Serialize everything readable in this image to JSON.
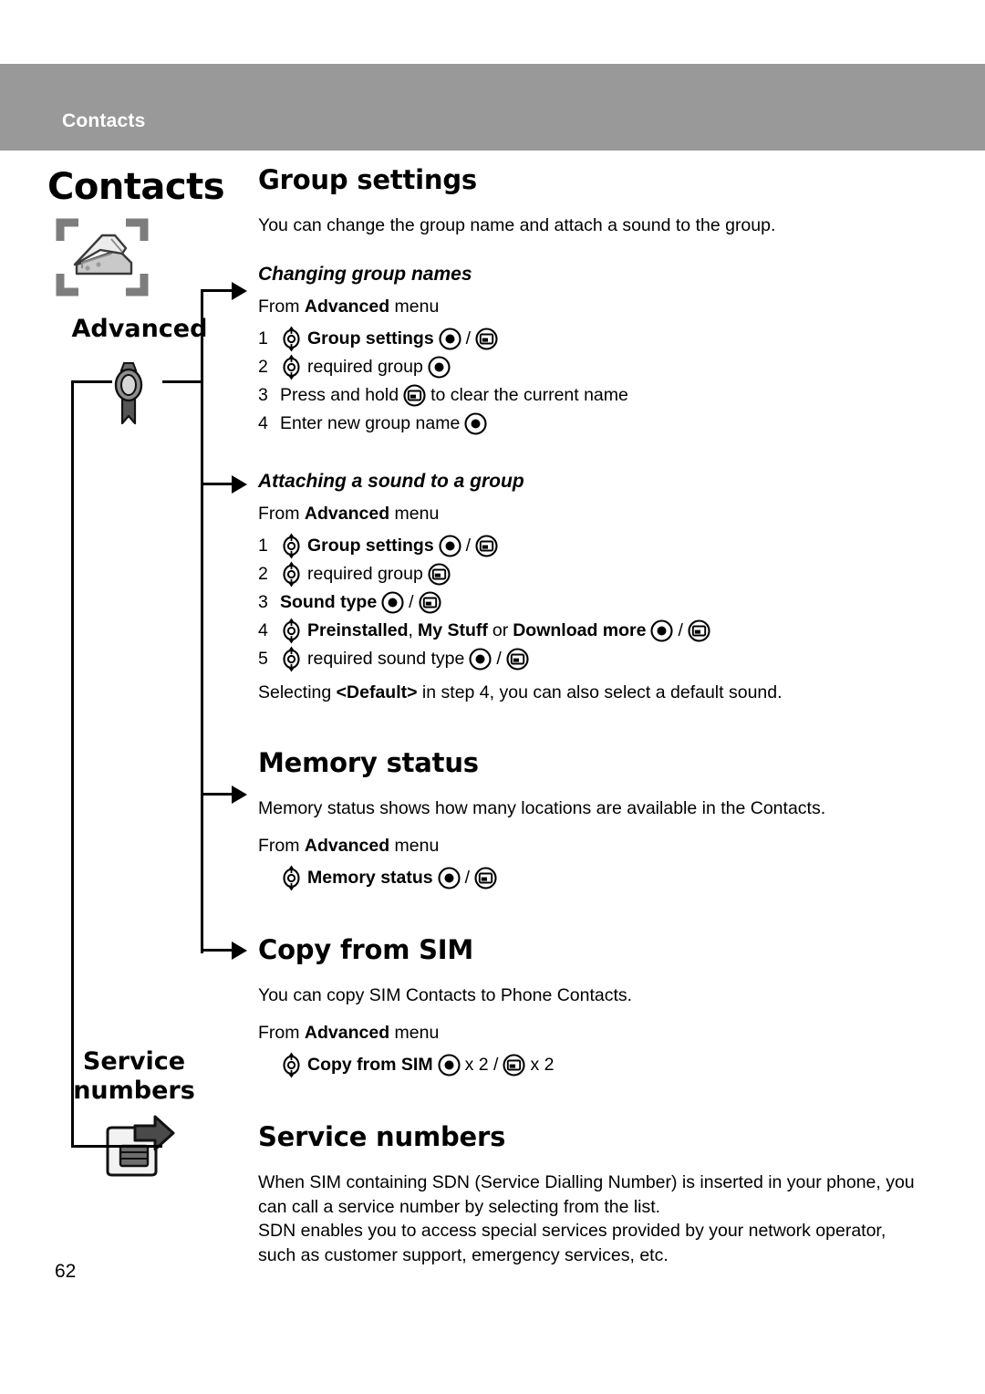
{
  "header": {
    "running_title": "Contacts",
    "band_color": "#999999"
  },
  "sidebar": {
    "chapter_title": "Contacts",
    "chapter_icon": "contacts-card-file-icon",
    "nav_items": [
      {
        "label": "Advanced",
        "icon": "award-ribbon-icon"
      },
      {
        "label": "Service\nnumbers",
        "label_line1": "Service",
        "label_line2": "numbers",
        "icon": "sim-card-export-icon"
      }
    ]
  },
  "icons": {
    "nav_key": "navigation-up-down-key-icon",
    "ok_key": "ok-select-key-icon",
    "soft_key": "left-soft-key-icon"
  },
  "content": {
    "sections": [
      {
        "id": "group-settings",
        "heading": "Group settings",
        "intro": "You can change the group name and attach a sound to the group.",
        "subsections": [
          {
            "id": "changing-group-names",
            "subheading": "Changing group names",
            "from_prefix": "From ",
            "from_bold": "Advanced",
            "from_suffix": " menu",
            "steps": [
              {
                "num": "1",
                "parts": [
                  {
                    "type": "icon",
                    "icon": "nav_key"
                  },
                  {
                    "type": "text",
                    "text": "Group settings",
                    "bold": true
                  },
                  {
                    "type": "icon",
                    "icon": "ok_key"
                  },
                  {
                    "type": "text",
                    "text": "/",
                    "bold": false
                  },
                  {
                    "type": "icon",
                    "icon": "soft_key"
                  }
                ]
              },
              {
                "num": "2",
                "parts": [
                  {
                    "type": "icon",
                    "icon": "nav_key"
                  },
                  {
                    "type": "text",
                    "text": "required group",
                    "bold": false
                  },
                  {
                    "type": "icon",
                    "icon": "ok_key"
                  }
                ]
              },
              {
                "num": "3",
                "parts": [
                  {
                    "type": "text",
                    "text": "Press and hold",
                    "bold": false
                  },
                  {
                    "type": "icon",
                    "icon": "soft_key"
                  },
                  {
                    "type": "text",
                    "text": "to clear the current name",
                    "bold": false
                  }
                ]
              },
              {
                "num": "4",
                "parts": [
                  {
                    "type": "text",
                    "text": "Enter new group name",
                    "bold": false
                  },
                  {
                    "type": "icon",
                    "icon": "ok_key"
                  }
                ]
              }
            ],
            "note": ""
          },
          {
            "id": "attaching-a-sound-to-a-group",
            "subheading": "Attaching a sound to a group",
            "from_prefix": "From ",
            "from_bold": "Advanced",
            "from_suffix": " menu",
            "steps": [
              {
                "num": "1",
                "parts": [
                  {
                    "type": "icon",
                    "icon": "nav_key"
                  },
                  {
                    "type": "text",
                    "text": "Group settings",
                    "bold": true
                  },
                  {
                    "type": "icon",
                    "icon": "ok_key"
                  },
                  {
                    "type": "text",
                    "text": "/",
                    "bold": false
                  },
                  {
                    "type": "icon",
                    "icon": "soft_key"
                  }
                ]
              },
              {
                "num": "2",
                "parts": [
                  {
                    "type": "icon",
                    "icon": "nav_key"
                  },
                  {
                    "type": "text",
                    "text": "required group",
                    "bold": false
                  },
                  {
                    "type": "icon",
                    "icon": "soft_key"
                  }
                ]
              },
              {
                "num": "3",
                "parts": [
                  {
                    "type": "text",
                    "text": "Sound type",
                    "bold": true
                  },
                  {
                    "type": "icon",
                    "icon": "ok_key"
                  },
                  {
                    "type": "text",
                    "text": "/",
                    "bold": false
                  },
                  {
                    "type": "icon",
                    "icon": "soft_key"
                  }
                ]
              },
              {
                "num": "4",
                "parts": [
                  {
                    "type": "icon",
                    "icon": "nav_key"
                  },
                  {
                    "type": "text",
                    "text": "Preinstalled",
                    "bold": true
                  },
                  {
                    "type": "text",
                    "text": ",",
                    "bold": false,
                    "tight": true
                  },
                  {
                    "type": "text",
                    "text": "My Stuff",
                    "bold": true
                  },
                  {
                    "type": "text",
                    "text": "or",
                    "bold": false
                  },
                  {
                    "type": "text",
                    "text": "Download more",
                    "bold": true
                  },
                  {
                    "type": "icon",
                    "icon": "ok_key"
                  },
                  {
                    "type": "text",
                    "text": "/",
                    "bold": false
                  },
                  {
                    "type": "icon",
                    "icon": "soft_key"
                  }
                ]
              },
              {
                "num": "5",
                "parts": [
                  {
                    "type": "icon",
                    "icon": "nav_key"
                  },
                  {
                    "type": "text",
                    "text": "required sound type",
                    "bold": false
                  },
                  {
                    "type": "icon",
                    "icon": "ok_key"
                  },
                  {
                    "type": "text",
                    "text": "/",
                    "bold": false
                  },
                  {
                    "type": "icon",
                    "icon": "soft_key"
                  }
                ]
              }
            ],
            "note_prefix": "Selecting ",
            "note_bold": "<Default>",
            "note_suffix": " in step 4, you can also select a default sound."
          }
        ]
      },
      {
        "id": "memory-status",
        "heading": "Memory status",
        "intro": "Memory status shows how many locations are available in the Contacts.",
        "from_prefix": "From ",
        "from_bold": "Advanced",
        "from_suffix": " menu",
        "steps": [
          {
            "num": "",
            "parts": [
              {
                "type": "icon",
                "icon": "nav_key"
              },
              {
                "type": "text",
                "text": "Memory status",
                "bold": true
              },
              {
                "type": "icon",
                "icon": "ok_key"
              },
              {
                "type": "text",
                "text": "/",
                "bold": false
              },
              {
                "type": "icon",
                "icon": "soft_key"
              }
            ]
          }
        ]
      },
      {
        "id": "copy-from-sim",
        "heading": "Copy from SIM",
        "intro": "You can copy SIM Contacts to Phone Contacts.",
        "from_prefix": "From ",
        "from_bold": "Advanced",
        "from_suffix": " menu",
        "steps": [
          {
            "num": "",
            "parts": [
              {
                "type": "icon",
                "icon": "nav_key"
              },
              {
                "type": "text",
                "text": "Copy from SIM",
                "bold": true
              },
              {
                "type": "icon",
                "icon": "ok_key"
              },
              {
                "type": "text",
                "text": "x 2 /",
                "bold": false
              },
              {
                "type": "icon",
                "icon": "soft_key"
              },
              {
                "type": "text",
                "text": "x 2",
                "bold": false
              }
            ]
          }
        ]
      },
      {
        "id": "service-numbers",
        "heading": "Service numbers",
        "paragraphs": [
          "When SIM containing SDN (Service Dialling Number) is inserted in your phone, you can call a service number by selecting from the list.",
          "SDN enables you to access special services provided by your network operator, such as customer support, emergency services, etc."
        ]
      }
    ]
  },
  "footer": {
    "page_number": "62"
  }
}
